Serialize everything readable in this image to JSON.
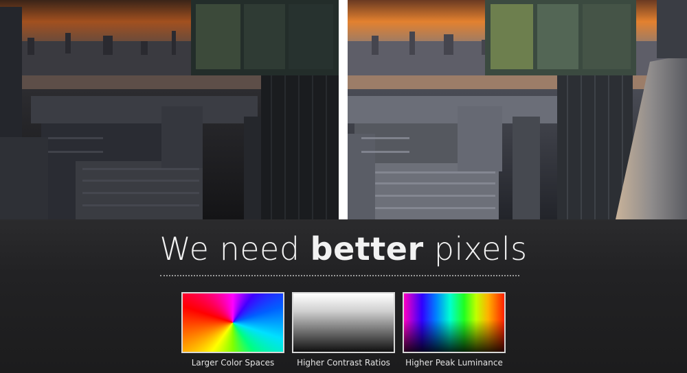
{
  "headline": {
    "part1": "We need ",
    "emphasis": "better",
    "part2": " pixels"
  },
  "swatches": [
    {
      "label": "Larger Color Spaces"
    },
    {
      "label": "Higher Contrast Ratios"
    },
    {
      "label": "Higher Peak Luminance"
    }
  ],
  "colors": {
    "background": "#1b1b1c",
    "text": "#f2f2f2",
    "sky_left": "#c25a1e",
    "sky_right": "#e07a2a"
  }
}
